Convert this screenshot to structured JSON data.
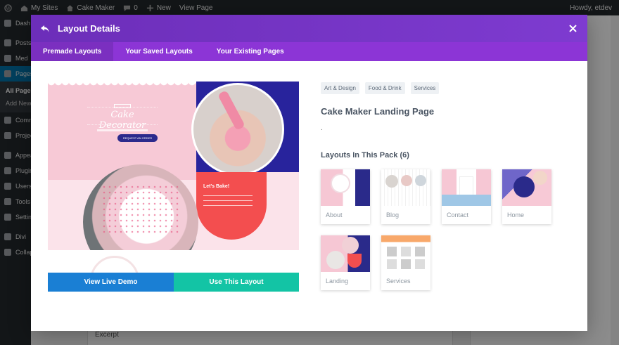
{
  "adminbar": {
    "my_sites": "My Sites",
    "site_name": "Cake Maker",
    "comments": "0",
    "new": "New",
    "view_page": "View Page",
    "howdy": "Howdy, etdev"
  },
  "sidebar": {
    "items": [
      "Dash",
      "Posts",
      "Med",
      "Pages",
      "Comments",
      "Projects",
      "Appearance",
      "Plugins",
      "Users",
      "Tools",
      "Settings",
      "Divi",
      "Collapse"
    ],
    "submenu": [
      "All Pages",
      "Add New"
    ]
  },
  "background": {
    "excerpt": "Excerpt"
  },
  "modal": {
    "title": "Layout Details",
    "tabs": [
      "Premade Layouts",
      "Your Saved Layouts",
      "Your Existing Pages"
    ],
    "preview": {
      "script_title": "Cake Decorator",
      "request_btn": "REQUEST AN ORDER",
      "red_title": "Let's Bake!"
    },
    "demo_button": "View Live Demo",
    "use_button": "Use This Layout",
    "tags": [
      "Art & Design",
      "Food & Drink",
      "Services"
    ],
    "layout_name": "Cake Maker Landing Page",
    "description": ".",
    "pack_heading": "Layouts In This Pack (6)",
    "layouts": [
      "About",
      "Blog",
      "Contact",
      "Home",
      "Landing",
      "Services"
    ]
  },
  "colors": {
    "header": "#7e3bd0",
    "tabs": "#8c35d6",
    "demo_button": "#1a7fd4",
    "use_button": "#13c4a5"
  }
}
